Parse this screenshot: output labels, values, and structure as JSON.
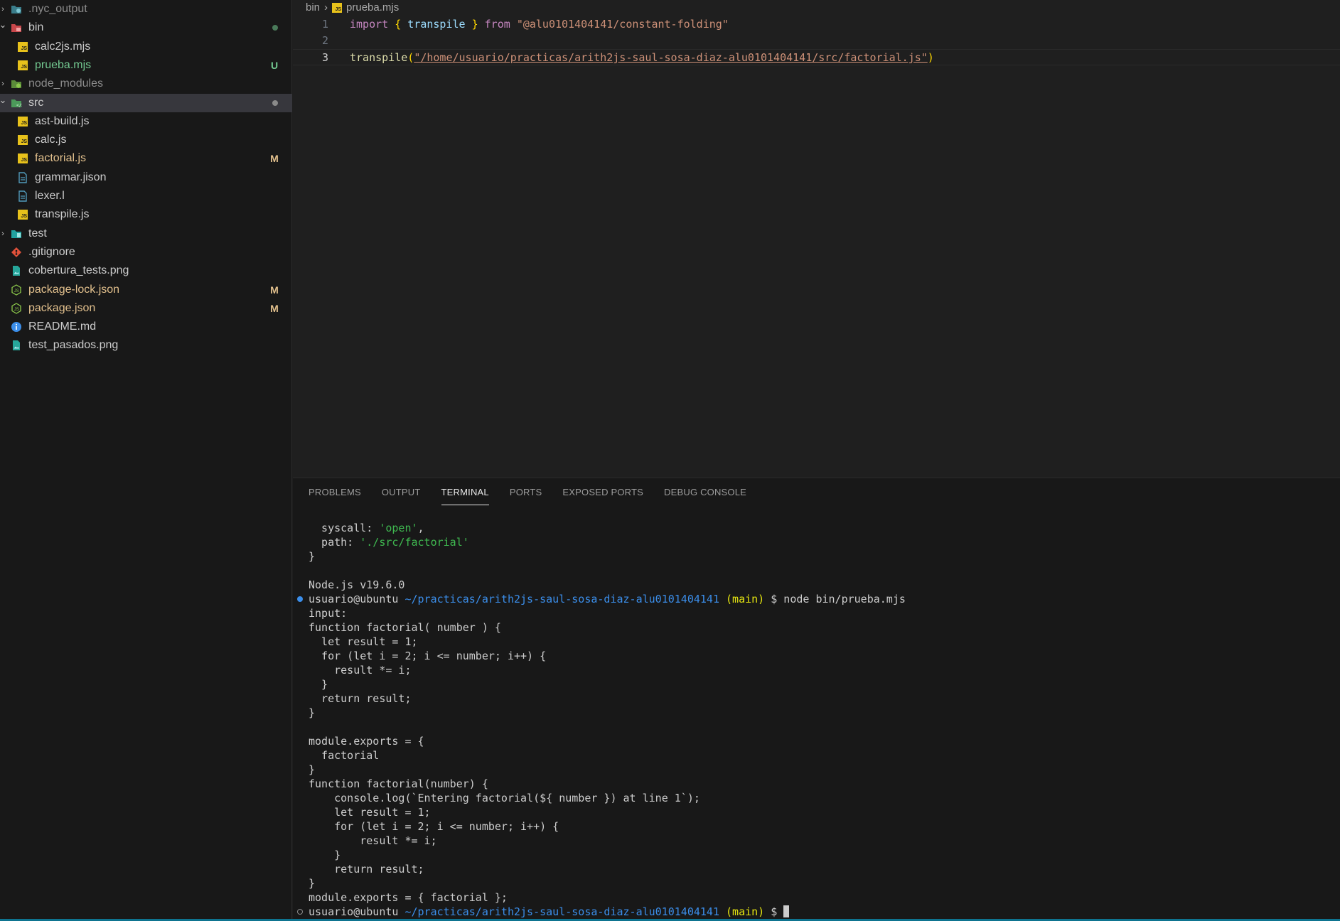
{
  "explorer": {
    "items": [
      {
        "label": ".nyc_output",
        "depth": 0,
        "kind": "folder",
        "twisty": "›",
        "icon": "folder-nyc-icon",
        "color": "#8c8c8c",
        "badge": ""
      },
      {
        "label": "bin",
        "depth": 0,
        "kind": "folder",
        "twisty": "⌄",
        "icon": "folder-bin-icon",
        "color": "#cccccc",
        "badge_dot": "#4a7a5a"
      },
      {
        "label": "calc2js.mjs",
        "depth": 1,
        "kind": "js",
        "icon": "js-file-icon",
        "color": "#cccccc",
        "badge": ""
      },
      {
        "label": "prueba.mjs",
        "depth": 1,
        "kind": "js",
        "icon": "js-file-icon",
        "color": "#73c991",
        "badge": "U"
      },
      {
        "label": "node_modules",
        "depth": 0,
        "kind": "folder",
        "twisty": "›",
        "icon": "folder-node-icon",
        "color": "#8c8c8c",
        "badge": ""
      },
      {
        "label": "src",
        "depth": 0,
        "kind": "folder",
        "twisty": "⌄",
        "icon": "folder-src-icon",
        "color": "#cccccc",
        "badge_dot": "#8a8a8a",
        "selected": true
      },
      {
        "label": "ast-build.js",
        "depth": 1,
        "kind": "js",
        "icon": "js-file-icon",
        "color": "#cccccc",
        "badge": ""
      },
      {
        "label": "calc.js",
        "depth": 1,
        "kind": "js",
        "icon": "js-file-icon",
        "color": "#cccccc",
        "badge": ""
      },
      {
        "label": "factorial.js",
        "depth": 1,
        "kind": "js",
        "icon": "js-file-icon",
        "color": "#e2c08d",
        "badge": "M"
      },
      {
        "label": "grammar.jison",
        "depth": 1,
        "kind": "doc",
        "icon": "document-file-icon",
        "color": "#cccccc",
        "badge": ""
      },
      {
        "label": "lexer.l",
        "depth": 1,
        "kind": "doc",
        "icon": "document-file-icon",
        "color": "#cccccc",
        "badge": ""
      },
      {
        "label": "transpile.js",
        "depth": 1,
        "kind": "js",
        "icon": "js-file-icon",
        "color": "#cccccc",
        "badge": ""
      },
      {
        "label": "test",
        "depth": 0,
        "kind": "folder",
        "twisty": "›",
        "icon": "folder-test-icon",
        "color": "#cccccc",
        "badge": ""
      },
      {
        "label": ".gitignore",
        "depth": 0,
        "kind": "git",
        "icon": "git-file-icon",
        "color": "#cccccc",
        "badge": ""
      },
      {
        "label": "cobertura_tests.png",
        "depth": 0,
        "kind": "image",
        "icon": "image-file-icon",
        "color": "#cccccc",
        "badge": ""
      },
      {
        "label": "package-lock.json",
        "depth": 0,
        "kind": "node",
        "icon": "node-file-icon",
        "color": "#e2c08d",
        "badge": "M"
      },
      {
        "label": "package.json",
        "depth": 0,
        "kind": "node",
        "icon": "node-file-icon",
        "color": "#e2c08d",
        "badge": "M"
      },
      {
        "label": "README.md",
        "depth": 0,
        "kind": "info",
        "icon": "info-file-icon",
        "color": "#cccccc",
        "badge": ""
      },
      {
        "label": "test_pasados.png",
        "depth": 0,
        "kind": "image",
        "icon": "image-file-icon",
        "color": "#cccccc",
        "badge": ""
      }
    ],
    "badge_colors": {
      "U": "#73c991",
      "M": "#e2c08d"
    }
  },
  "breadcrumb": {
    "folder": "bin",
    "separator": "›",
    "file": "prueba.mjs"
  },
  "editor": {
    "lines": [
      {
        "number": "1",
        "tokens": [
          {
            "t": "import",
            "c": "kw"
          },
          {
            "t": " ",
            "c": "plain"
          },
          {
            "t": "{",
            "c": "p"
          },
          {
            "t": " ",
            "c": "plain"
          },
          {
            "t": "transpile",
            "c": "id"
          },
          {
            "t": " ",
            "c": "plain"
          },
          {
            "t": "}",
            "c": "p"
          },
          {
            "t": " ",
            "c": "plain"
          },
          {
            "t": "from",
            "c": "kw"
          },
          {
            "t": " ",
            "c": "plain"
          },
          {
            "t": "\"@alu0101404141/constant-folding\"",
            "c": "str"
          }
        ]
      },
      {
        "number": "2",
        "tokens": []
      },
      {
        "number": "3",
        "current": true,
        "tokens": [
          {
            "t": "transpile",
            "c": "fn"
          },
          {
            "t": "(",
            "c": "p"
          },
          {
            "t": "\"/home/usuario/practicas/arith2js-saul-sosa-diaz-alu0101404141/src/factorial.js\"",
            "c": "str",
            "u": true
          },
          {
            "t": ")",
            "c": "p"
          }
        ]
      }
    ]
  },
  "panel": {
    "tabs": [
      "PROBLEMS",
      "OUTPUT",
      "TERMINAL",
      "PORTS",
      "EXPOSED PORTS",
      "DEBUG CONSOLE"
    ],
    "active_tab": "TERMINAL"
  },
  "terminal": {
    "lines": [
      {
        "segs": [
          {
            "t": "  syscall: "
          },
          {
            "t": "'open'",
            "c": "green"
          },
          {
            "t": ","
          }
        ]
      },
      {
        "segs": [
          {
            "t": "  path: "
          },
          {
            "t": "'./src/factorial'",
            "c": "green"
          }
        ]
      },
      {
        "segs": [
          {
            "t": "}"
          }
        ]
      },
      {
        "segs": [
          {
            "t": ""
          }
        ]
      },
      {
        "segs": [
          {
            "t": "Node.js v19.6.0"
          }
        ]
      },
      {
        "mark": "filled",
        "segs": [
          {
            "t": "usuario@ubuntu "
          },
          {
            "t": "~/practicas/arith2js-saul-sosa-diaz-alu0101404141",
            "c": "path"
          },
          {
            "t": " "
          },
          {
            "t": "(main)",
            "c": "yellow"
          },
          {
            "t": " $ node bin/prueba.mjs"
          }
        ]
      },
      {
        "segs": [
          {
            "t": "input:"
          }
        ]
      },
      {
        "segs": [
          {
            "t": "function factorial( number ) {"
          }
        ]
      },
      {
        "segs": [
          {
            "t": "  let result = 1;"
          }
        ]
      },
      {
        "segs": [
          {
            "t": "  for (let i = 2; i <= number; i++) {"
          }
        ]
      },
      {
        "segs": [
          {
            "t": "    result *= i;"
          }
        ]
      },
      {
        "segs": [
          {
            "t": "  }"
          }
        ]
      },
      {
        "segs": [
          {
            "t": "  return result;"
          }
        ]
      },
      {
        "segs": [
          {
            "t": "}"
          }
        ]
      },
      {
        "segs": [
          {
            "t": ""
          }
        ]
      },
      {
        "segs": [
          {
            "t": "module.exports = {"
          }
        ]
      },
      {
        "segs": [
          {
            "t": "  factorial"
          }
        ]
      },
      {
        "segs": [
          {
            "t": "}"
          }
        ]
      },
      {
        "segs": [
          {
            "t": "function factorial(number) {"
          }
        ]
      },
      {
        "segs": [
          {
            "t": "    console.log(`Entering factorial(${ number }) at line 1`);"
          }
        ]
      },
      {
        "segs": [
          {
            "t": "    let result = 1;"
          }
        ]
      },
      {
        "segs": [
          {
            "t": "    for (let i = 2; i <= number; i++) {"
          }
        ]
      },
      {
        "segs": [
          {
            "t": "        result *= i;"
          }
        ]
      },
      {
        "segs": [
          {
            "t": "    }"
          }
        ]
      },
      {
        "segs": [
          {
            "t": "    return result;"
          }
        ]
      },
      {
        "segs": [
          {
            "t": "}"
          }
        ]
      },
      {
        "segs": [
          {
            "t": "module.exports = { factorial };"
          }
        ]
      },
      {
        "mark": "hollow",
        "cursor": true,
        "segs": [
          {
            "t": "usuario@ubuntu "
          },
          {
            "t": "~/practicas/arith2js-saul-sosa-diaz-alu0101404141",
            "c": "path"
          },
          {
            "t": " "
          },
          {
            "t": "(main)",
            "c": "yellow"
          },
          {
            "t": " $ "
          }
        ]
      }
    ]
  },
  "colors": {
    "accent": "#0e7490",
    "mark_filled": "#3b8eea",
    "mark_hollow": "#8c8c8c"
  }
}
